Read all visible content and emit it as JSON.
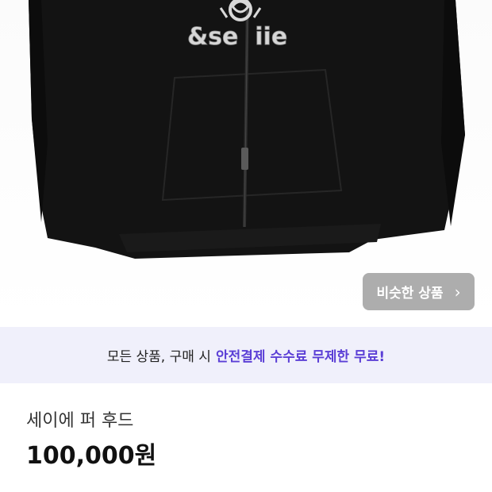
{
  "product": {
    "logo_text": "&se  iie",
    "title": "세이에 퍼 후드",
    "price": "100,000원"
  },
  "similar_button": {
    "label": "비슷한 상품",
    "chevron": "›"
  },
  "banner": {
    "prefix": "모든 상품, 구매 시",
    "highlight": "안전결제 수수료 무제한 무료!"
  },
  "colors": {
    "accent": "#5b3fd6",
    "banner_bg": "#f0f0fb",
    "hoodie": "#121212"
  }
}
